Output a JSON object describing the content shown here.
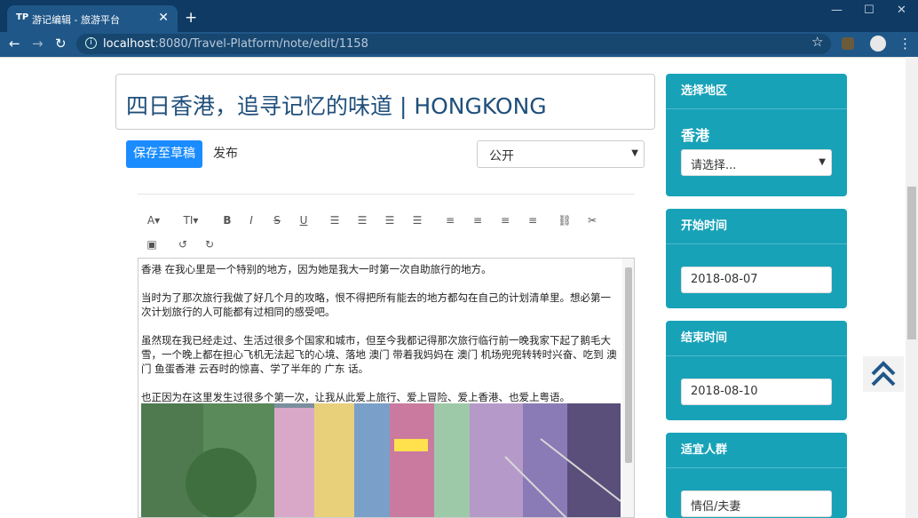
{
  "browser": {
    "tab_title": "游记编辑 - 旅游平台",
    "url_host": "localhost",
    "url_path": ":8080/Travel-Platform/note/edit/1158"
  },
  "note": {
    "title": "四日香港，追寻记忆的味道 | HONGKONG",
    "save_draft_label": "保存至草稿",
    "publish_label": "发布",
    "visibility": "公开",
    "paragraphs": [
      "香港 在我心里是一个特别的地方，因为她是我大一时第一次自助旅行的地方。",
      "当时为了那次旅行我做了好几个月的攻略，恨不得把所有能去的地方都勾在自己的计划清单里。想必第一次计划旅行的人可能都有过相同的感受吧。",
      "虽然现在我已经走过、生活过很多个国家和城市，但至今我都记得那次旅行临行前一晚我家下起了鹅毛大雪，一个晚上都在担心飞机无法起飞的心境、落地 澳门 带着我妈妈在 澳门 机场兜兜转转时兴奋、吃到 澳门 鱼蛋香港 云吞时的惊喜、学了半年的 广东 话。",
      "也正因为在这里发生过很多个第一次，让我从此爱上旅行、爱上冒险、爱上香港、也爱上粤语。"
    ]
  },
  "sidebar": {
    "region_header": "选择地区",
    "region_value": "香港",
    "region_select": "请选择...",
    "start_header": "开始时间",
    "start_value": "2018-08-07",
    "end_header": "结束时间",
    "end_value": "2018-08-10",
    "people_header": "适宜人群",
    "people_value": "情侣/夫妻"
  },
  "colors": {
    "accent": "#17a2b8",
    "primary_button": "#1a8cff",
    "chrome": "#1f5788"
  }
}
